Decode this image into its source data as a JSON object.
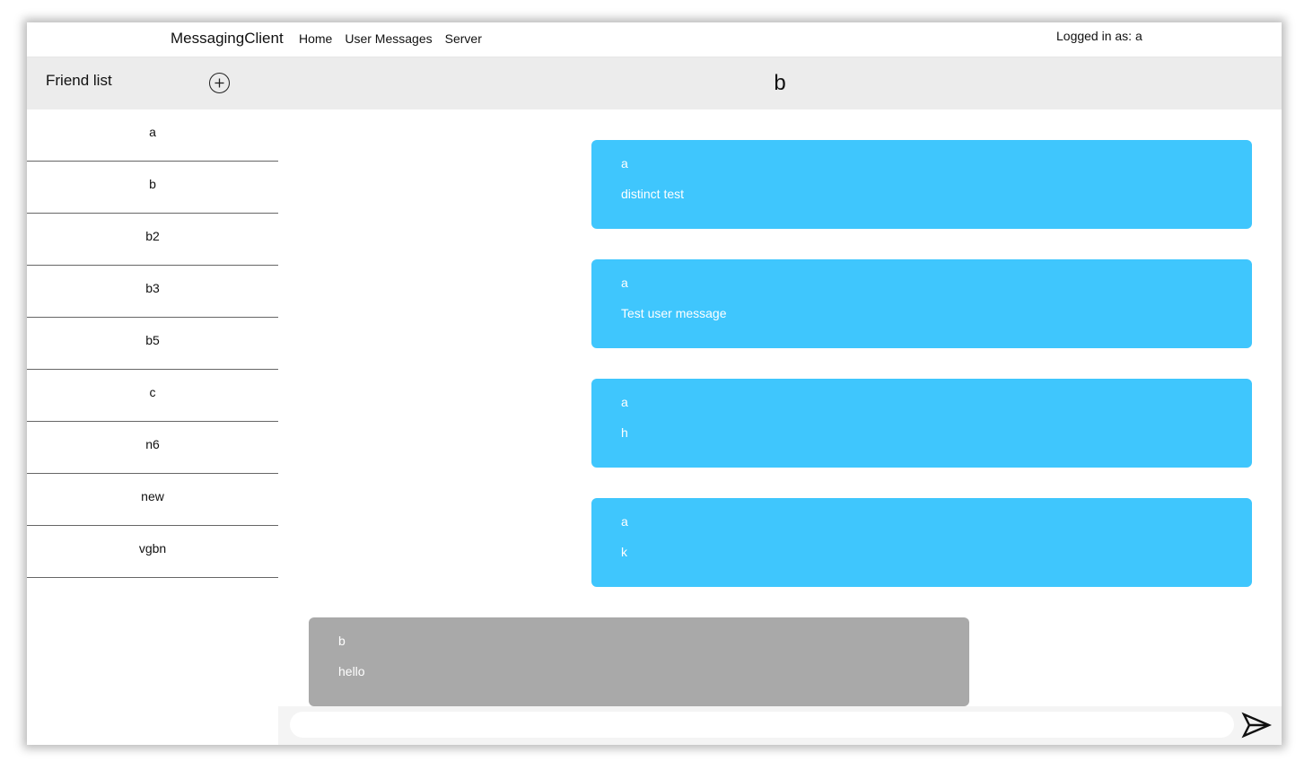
{
  "navbar": {
    "brand": "MessagingClient",
    "links": [
      "Home",
      "User Messages",
      "Server"
    ],
    "logged_in_text": "Logged in as: a"
  },
  "sidebar": {
    "title": "Friend list",
    "add_icon": "plus-circle-icon",
    "friends": [
      "a",
      "b",
      "b2",
      "b3",
      "b5",
      "c",
      "n6",
      "new",
      "vgbn"
    ]
  },
  "chat": {
    "title": "b",
    "messages": [
      {
        "sender": "a",
        "text": "distinct test",
        "direction": "sent"
      },
      {
        "sender": "a",
        "text": "Test user message",
        "direction": "sent"
      },
      {
        "sender": "a",
        "text": "h",
        "direction": "sent"
      },
      {
        "sender": "a",
        "text": "k",
        "direction": "sent"
      },
      {
        "sender": "b",
        "text": "hello",
        "direction": "received"
      }
    ]
  },
  "composer": {
    "placeholder": "",
    "value": "",
    "send_icon": "send-arrow-icon"
  },
  "colors": {
    "sent_bubble": "#3fc6fd",
    "received_bubble": "#a9a9a9",
    "header_bg": "#ececec"
  }
}
